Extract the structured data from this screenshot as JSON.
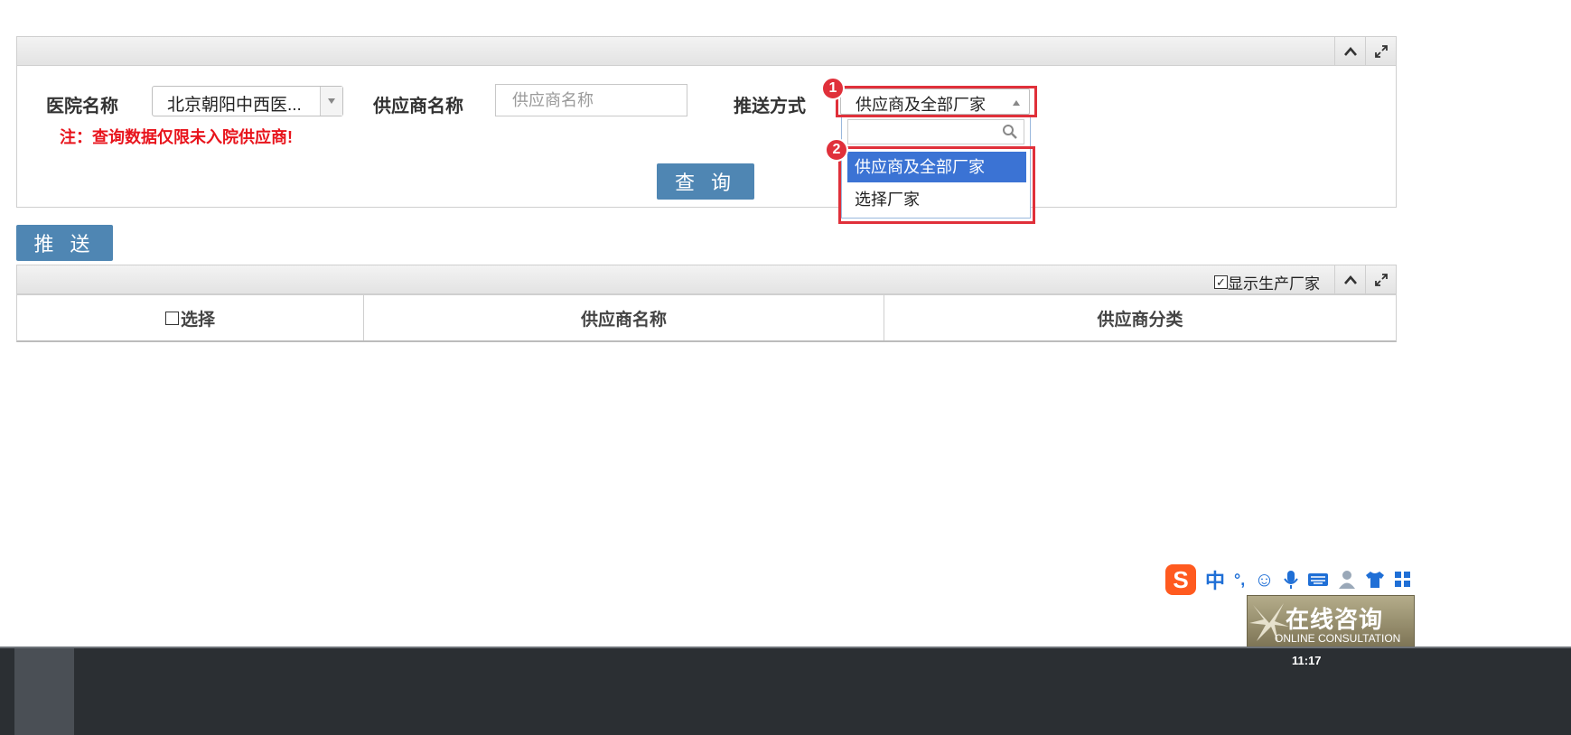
{
  "query_panel": {
    "collapse_icon": "chevron-up-icon",
    "expand_icon": "expand-icon"
  },
  "form": {
    "hospital_label": "医院名称",
    "hospital_value": "北京朝阳中西医...",
    "supplier_label": "供应商名称",
    "supplier_placeholder": "供应商名称",
    "push_mode_label": "推送方式",
    "push_mode_value": "供应商及全部厂家",
    "note": "注：查询数据仅限未入院供应商!",
    "query_button": "查 询"
  },
  "dropdown": {
    "search_value": "",
    "options": [
      {
        "label": "供应商及全部厂家",
        "selected": true
      },
      {
        "label": "选择厂家",
        "selected": false
      }
    ]
  },
  "annotations": {
    "badge1": "1",
    "badge2": "2"
  },
  "push_button": "推 送",
  "grid": {
    "show_manufacturer_label": "显示生产厂家",
    "show_manufacturer_checked": true,
    "select_all_label": "选择",
    "columns": [
      "供应商名称",
      "供应商分类"
    ]
  },
  "ime_toolbar": {
    "mode": "中",
    "punct": "°,"
  },
  "consult": {
    "title": "在线咨询",
    "subtitle": "ONLINE CONSULTATION"
  },
  "taskbar": {
    "time": "11:17"
  },
  "colors": {
    "accent": "#4f86b3",
    "highlight": "#e0303a",
    "selected": "#3b73d4"
  }
}
